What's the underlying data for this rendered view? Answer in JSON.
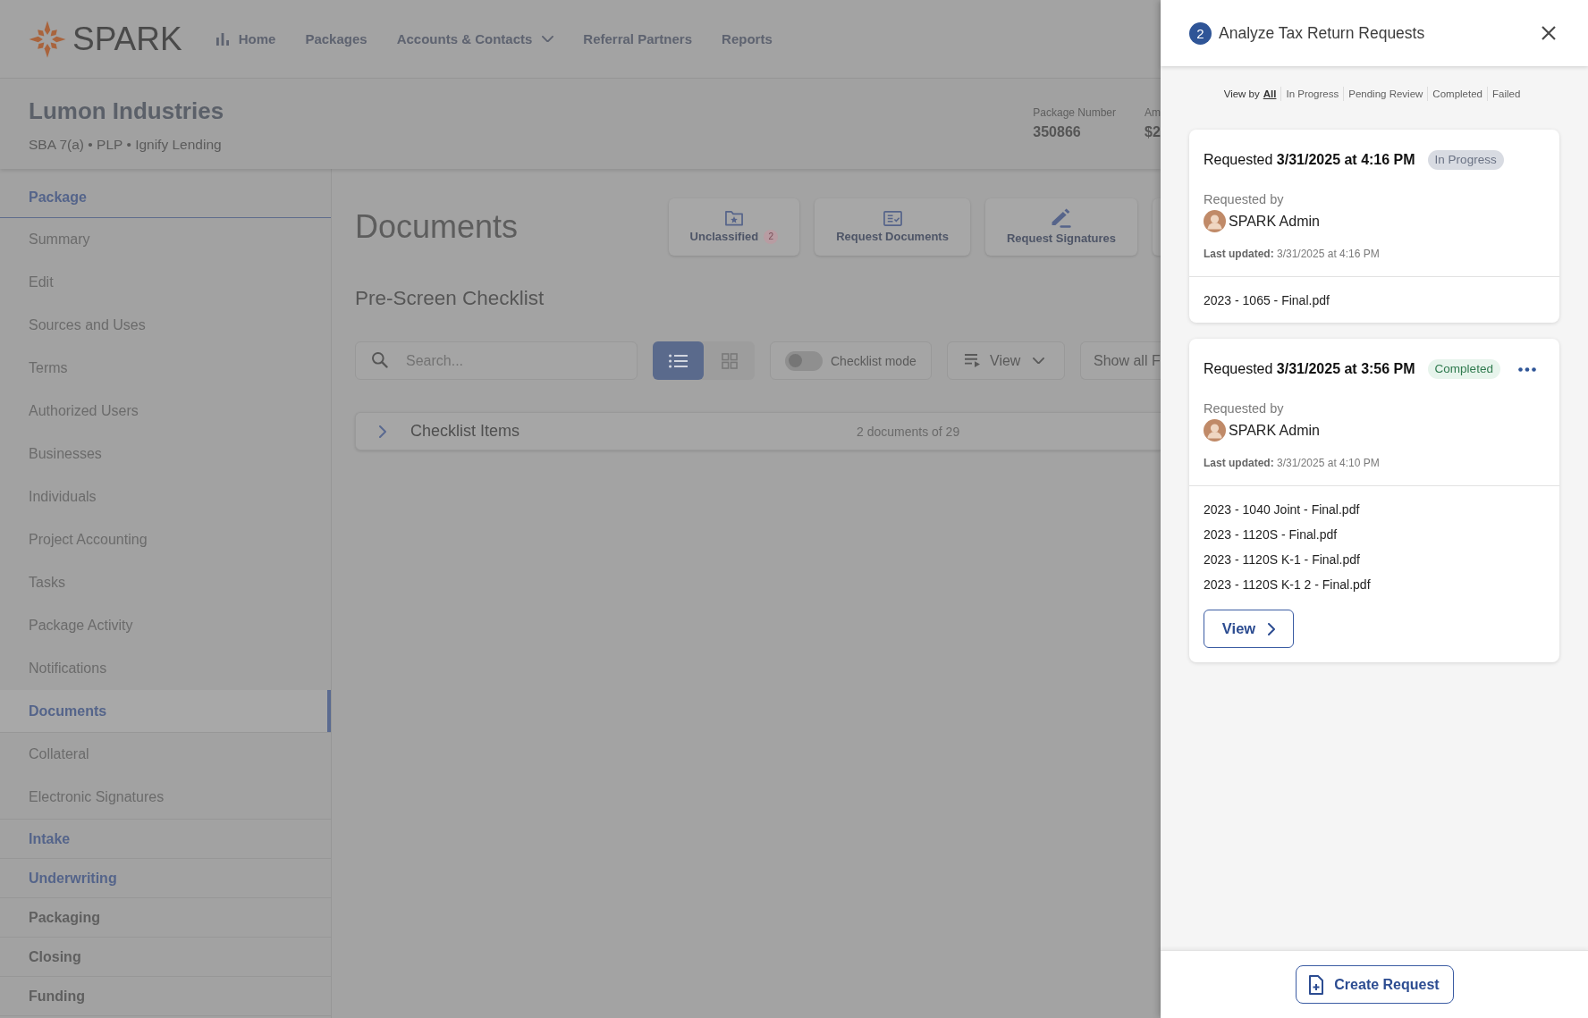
{
  "nav": {
    "logo": "SPARK",
    "items": [
      {
        "label": "Home",
        "kind": "dashboard"
      },
      {
        "label": "Packages",
        "kind": "link"
      },
      {
        "label": "Accounts & Contacts",
        "kind": "dropdown"
      },
      {
        "label": "Referral Partners",
        "kind": "link"
      },
      {
        "label": "Reports",
        "kind": "link"
      }
    ]
  },
  "header": {
    "title": "Lumon Industries",
    "subtitle": "SBA 7(a) • PLP • Ignify Lending",
    "meta": [
      {
        "label": "Package Number",
        "value": "350866"
      },
      {
        "label": "Am",
        "value": "$2"
      }
    ]
  },
  "sidebar": {
    "sections": [
      {
        "label": "Package",
        "expanded": true,
        "disabled": false,
        "items": [
          {
            "label": "Summary",
            "selected": false
          },
          {
            "label": "Edit",
            "selected": false
          },
          {
            "label": "Sources and Uses",
            "selected": false
          },
          {
            "label": "Terms",
            "selected": false
          },
          {
            "label": "Authorized Users",
            "selected": false
          },
          {
            "label": "Businesses",
            "selected": false
          },
          {
            "label": "Individuals",
            "selected": false
          },
          {
            "label": "Project Accounting",
            "selected": false
          },
          {
            "label": "Tasks",
            "selected": false
          },
          {
            "label": "Package Activity",
            "selected": false
          },
          {
            "label": "Notifications",
            "selected": false
          },
          {
            "label": "Documents",
            "selected": true
          },
          {
            "label": "Collateral",
            "selected": false
          },
          {
            "label": "Electronic Signatures",
            "selected": false
          }
        ]
      },
      {
        "label": "Intake",
        "expanded": false,
        "disabled": false
      },
      {
        "label": "Underwriting",
        "expanded": false,
        "disabled": false
      },
      {
        "label": "Packaging",
        "expanded": false,
        "disabled": true
      },
      {
        "label": "Closing",
        "expanded": false,
        "disabled": true
      },
      {
        "label": "Funding",
        "expanded": false,
        "disabled": true
      }
    ]
  },
  "main": {
    "title": "Documents",
    "actions": [
      {
        "label": "Unclassified",
        "kind": "folder",
        "count": "2"
      },
      {
        "label": "Request Documents",
        "kind": "checklist"
      },
      {
        "label": "Request Signatures",
        "kind": "signature"
      }
    ],
    "section_title": "Pre-Screen Checklist",
    "toolbar": {
      "search": {
        "placeholder": "Search..."
      },
      "view_modes": [
        {
          "kind": "list",
          "selected": true
        },
        {
          "kind": "grid",
          "selected": false
        }
      ],
      "checklist_mode": {
        "label": "Checklist mode",
        "on": false
      },
      "view_menu": {
        "label": "View"
      },
      "show_all": {
        "label": "Show all F"
      }
    },
    "groups": [
      {
        "label": "Checklist Items",
        "expanded": false,
        "count": "2 documents of 29"
      }
    ]
  },
  "panel": {
    "badge": "2",
    "title": "Analyze Tax Return Requests",
    "filter": {
      "label": "View by",
      "options": [
        {
          "label": "All",
          "selected": true
        },
        {
          "label": "In Progress",
          "selected": false
        },
        {
          "label": "Pending Review",
          "selected": false
        },
        {
          "label": "Completed",
          "selected": false
        },
        {
          "label": "Failed",
          "selected": false
        }
      ]
    },
    "requests": [
      {
        "title": "Requested **3/31/2025 at 4:16 PM**",
        "status": {
          "label": "In Progress",
          "kind": "progress"
        },
        "menu": false,
        "requested_by": "Requested by",
        "requester": "SPARK Admin",
        "updated": "**Last updated:** 3/31/2025 at 4:16 PM",
        "files": [
          "2023 - 1065 - Final.pdf"
        ]
      },
      {
        "title": "Requested **3/31/2025 at 3:56 PM**",
        "status": {
          "label": "Completed",
          "kind": "completed"
        },
        "menu": true,
        "requested_by": "Requested by",
        "requester": "SPARK Admin",
        "updated": "**Last updated:** 3/31/2025 at 4:10 PM",
        "files": [
          "2023 - 1040 Joint - Final.pdf",
          "2023 - 1120S - Final.pdf",
          "2023 - 1120S K-1 - Final.pdf",
          "2023 - 1120S K-1 2 - Final.pdf"
        ],
        "action": {
          "label": "View"
        }
      }
    ],
    "footer": {
      "button": "Create Request"
    }
  }
}
